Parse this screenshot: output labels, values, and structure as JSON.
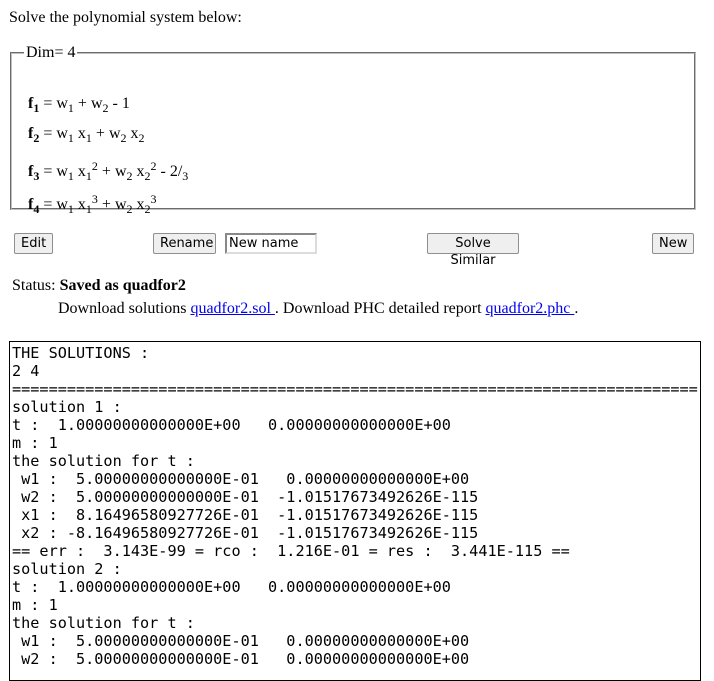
{
  "intro": "Solve the polynomial system below:",
  "system": {
    "legend": "Dim= 4",
    "equations": [
      {
        "lhs": "f",
        "lhs_sub": "1",
        "eq": " = "
      },
      {
        "lhs": "f",
        "lhs_sub": "2",
        "eq": " = "
      },
      {
        "lhs": "f",
        "lhs_sub": "3",
        "eq": " = "
      },
      {
        "lhs": "f",
        "lhs_sub": "4",
        "eq": " = "
      }
    ],
    "terms": {
      "w": "w",
      "x": "x",
      "one": "1",
      "two": "2",
      "three": "3",
      "plus": " + ",
      "minus_one": " - 1",
      "minus_two": " - 2",
      "slash": "/",
      "space": " "
    }
  },
  "buttons": {
    "edit": "Edit",
    "rename": "Rename",
    "solve_similar": "Solve Similar",
    "new": "New"
  },
  "rename_input": {
    "value": "New name"
  },
  "status": {
    "label": "Status: ",
    "value": "Saved as quadfor2"
  },
  "download": {
    "prefix": "Download solutions ",
    "sol_link": "quadfor2.sol ",
    "middle": ". Download PHC detailed report ",
    "phc_link": "quadfor2.phc ",
    "suffix": "."
  },
  "output": {
    "lines": [
      "THE SOLUTIONS :",
      "2 4",
      "===========================================================================",
      "solution 1 :",
      "t :  1.00000000000000E+00   0.00000000000000E+00",
      "m : 1",
      "the solution for t :",
      " w1 :  5.00000000000000E-01   0.00000000000000E+00",
      " w2 :  5.00000000000000E-01  -1.01517673492626E-115",
      " x1 :  8.16496580927726E-01  -1.01517673492626E-115",
      " x2 : -8.16496580927726E-01  -1.01517673492626E-115",
      "== err :  3.143E-99 = rco :  1.216E-01 = res :  3.441E-115 ==",
      "solution 2 :",
      "t :  1.00000000000000E+00   0.00000000000000E+00",
      "m : 1",
      "the solution for t :",
      " w1 :  5.00000000000000E-01   0.00000000000000E+00",
      " w2 :  5.00000000000000E-01   0.00000000000000E+00"
    ]
  }
}
